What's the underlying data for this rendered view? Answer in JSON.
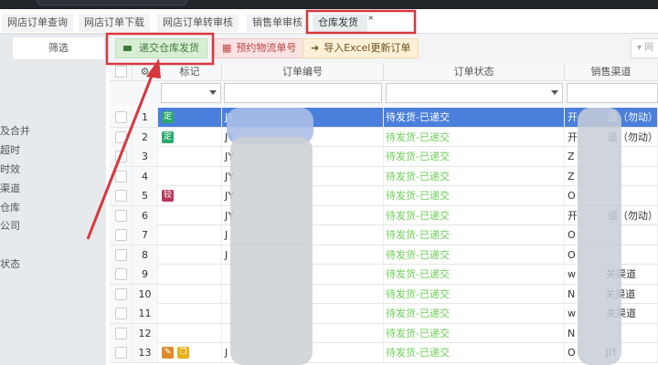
{
  "tabs": [
    "网店订单查询",
    "网店订单下载",
    "网店订单转审核",
    "销售单审核",
    "仓库发货"
  ],
  "tab_close": "×",
  "sidebar": {
    "filter_tab": "筛选",
    "items": [
      "及合并",
      "超时",
      "时效",
      "渠道",
      "仓库",
      "公司",
      "状态"
    ]
  },
  "toolbar": {
    "submit": "递交仓库发货",
    "reserve": "预约物流单号",
    "import": "导入Excel更新订单",
    "select_placeholder": "网"
  },
  "columns": {
    "mark": "标记",
    "order_no": "订单编号",
    "status": "订单状态",
    "channel": "销售渠道"
  },
  "rows": [
    {
      "idx": "1",
      "badges": [
        "定"
      ],
      "order": "JY",
      "status": "待发货-已递交",
      "channel": "开　　　道（勿动）"
    },
    {
      "idx": "2",
      "badges": [
        "定"
      ],
      "order": "JY",
      "status": "待发货-已递交",
      "channel": "开　　　道（勿动）"
    },
    {
      "idx": "3",
      "badges": [],
      "order": "JY",
      "status": "待发货-已递交",
      "channel": "Z"
    },
    {
      "idx": "4",
      "badges": [],
      "order": "JY",
      "status": "待发货-已递交",
      "channel": "Z"
    },
    {
      "idx": "5",
      "badges": [
        "较"
      ],
      "order": "JY",
      "status": "待发货-已递交",
      "channel": "O"
    },
    {
      "idx": "6",
      "badges": [],
      "order": "JY",
      "status": "待发货-已递交",
      "channel": "开　　　道（勿动）"
    },
    {
      "idx": "7",
      "badges": [],
      "order": "J",
      "status": "待发货-已递交",
      "channel": "O"
    },
    {
      "idx": "8",
      "badges": [],
      "order": "J",
      "status": "待发货-已递交",
      "channel": "O"
    },
    {
      "idx": "9",
      "badges": [],
      "order": "",
      "status": "待发货-已递交",
      "channel": "w　　　关渠道"
    },
    {
      "idx": "10",
      "badges": [],
      "order": "",
      "status": "待发货-已递交",
      "channel": "N　　　关渠道"
    },
    {
      "idx": "11",
      "badges": [],
      "order": "",
      "status": "待发货-已递交",
      "channel": "w　　　关渠道"
    },
    {
      "idx": "12",
      "badges": [],
      "order": "",
      "status": "待发货-已递交",
      "channel": "N"
    },
    {
      "idx": "13",
      "badges": [
        "wrench",
        "copy"
      ],
      "order": "J",
      "status": "待发货-已递交",
      "channel": "O　　　JIT"
    }
  ],
  "colors": {
    "accent": "#4a7fdc",
    "status_green": "#6ccf55",
    "annotation": "#d9363e"
  }
}
